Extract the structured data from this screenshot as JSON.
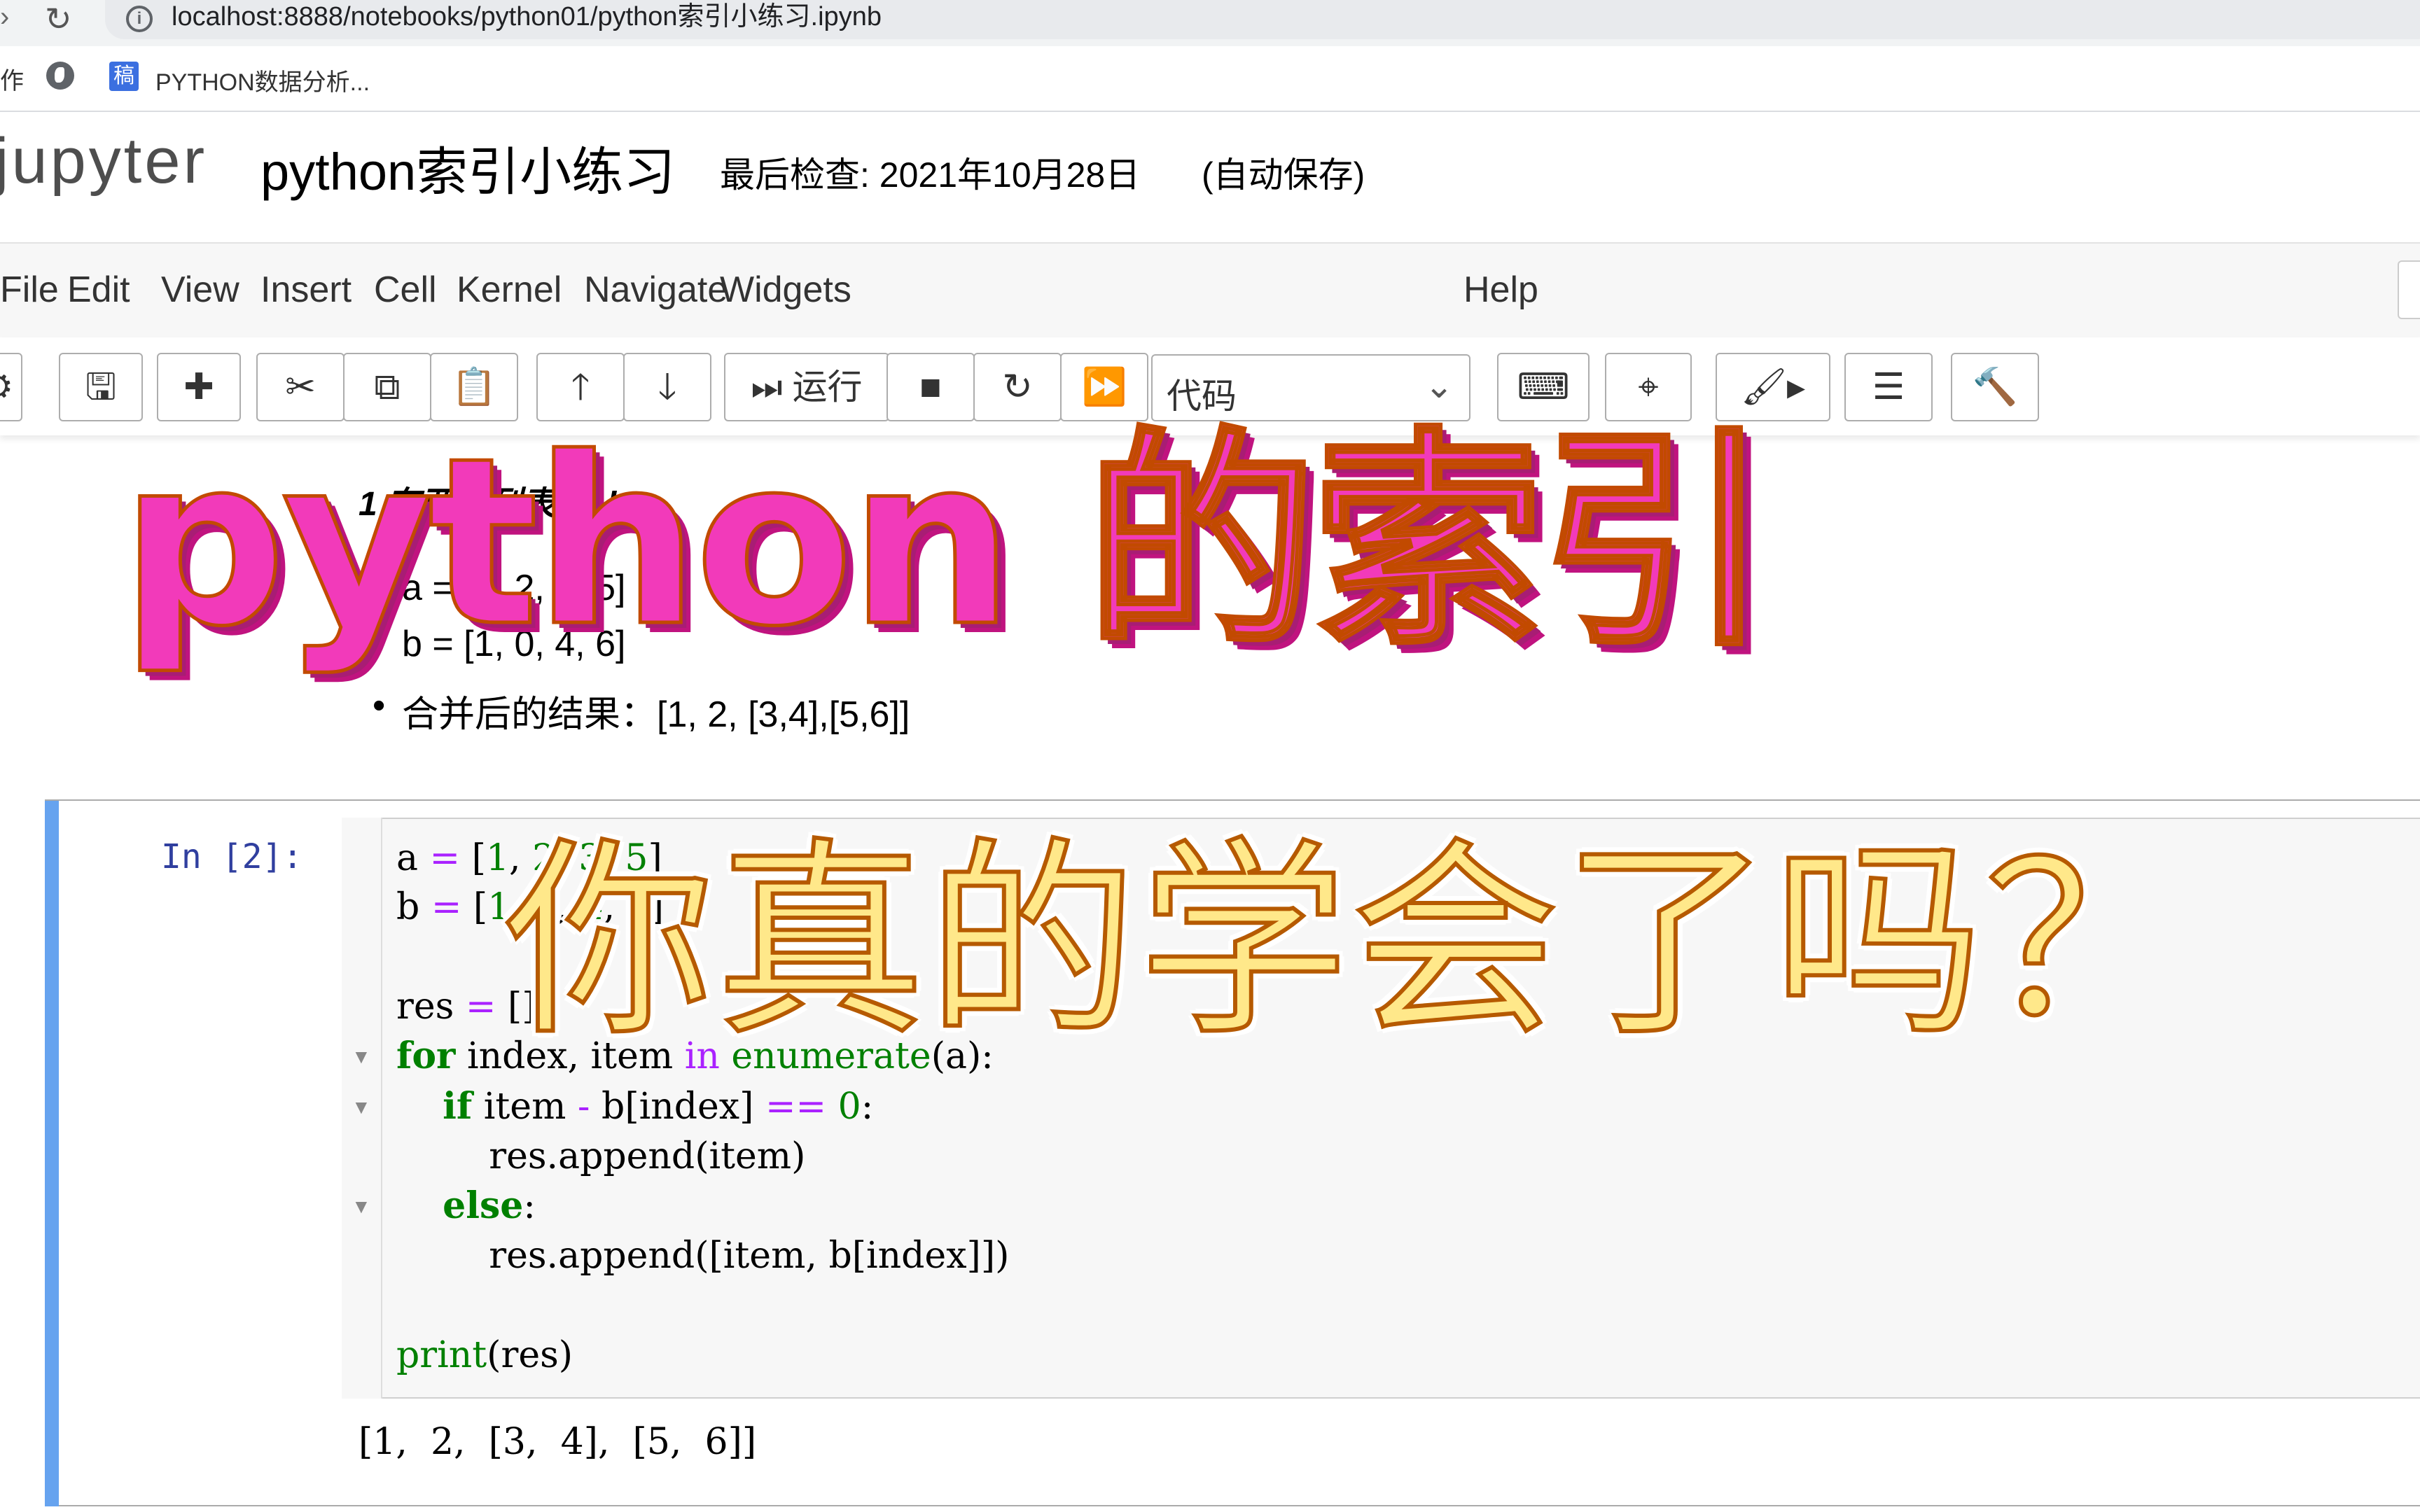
{
  "browser": {
    "url": "localhost:8888/notebooks/python01/python索引小练习.ipynb",
    "bookmark_prefix": "作",
    "bookmark_favicon": "稿",
    "bookmark_label": "PYTHON数据分析..."
  },
  "header": {
    "logo": "jupyter",
    "notebook_name": "python索引小练习",
    "checkpoint": "最后检查: 2021年10月28日",
    "autosave": "(自动保存)"
  },
  "menu": [
    "File",
    "Edit",
    "View",
    "Insert",
    "Cell",
    "Kernel",
    "Navigate",
    "Widgets",
    "Help"
  ],
  "toolbar": {
    "run_label": "运行",
    "cell_type": "代码"
  },
  "markdown": {
    "title": "1 有两个列表a，b",
    "bullet_a": "a = [1, 2, 3, 5]",
    "bullet_b": "b = [1, 0, 4, 6]",
    "bullet_result": "合并后的结果：[1, 2, [3,4],[5,6]]"
  },
  "cell": {
    "prompt": "In  [2]:",
    "output": "[1,  2,  [3,  4],  [5,  6]]"
  },
  "overlay": {
    "title": "python 的索引",
    "subtitle": "你真的学会了吗？"
  },
  "colors": {
    "prompt_in": "#303f9f",
    "cell_selected_bar": "#66a3ef",
    "keyword": "#008000",
    "operator": "#aa22ff",
    "overlay_pink": "#f23aba",
    "overlay_yellow": "#ffe88a"
  }
}
